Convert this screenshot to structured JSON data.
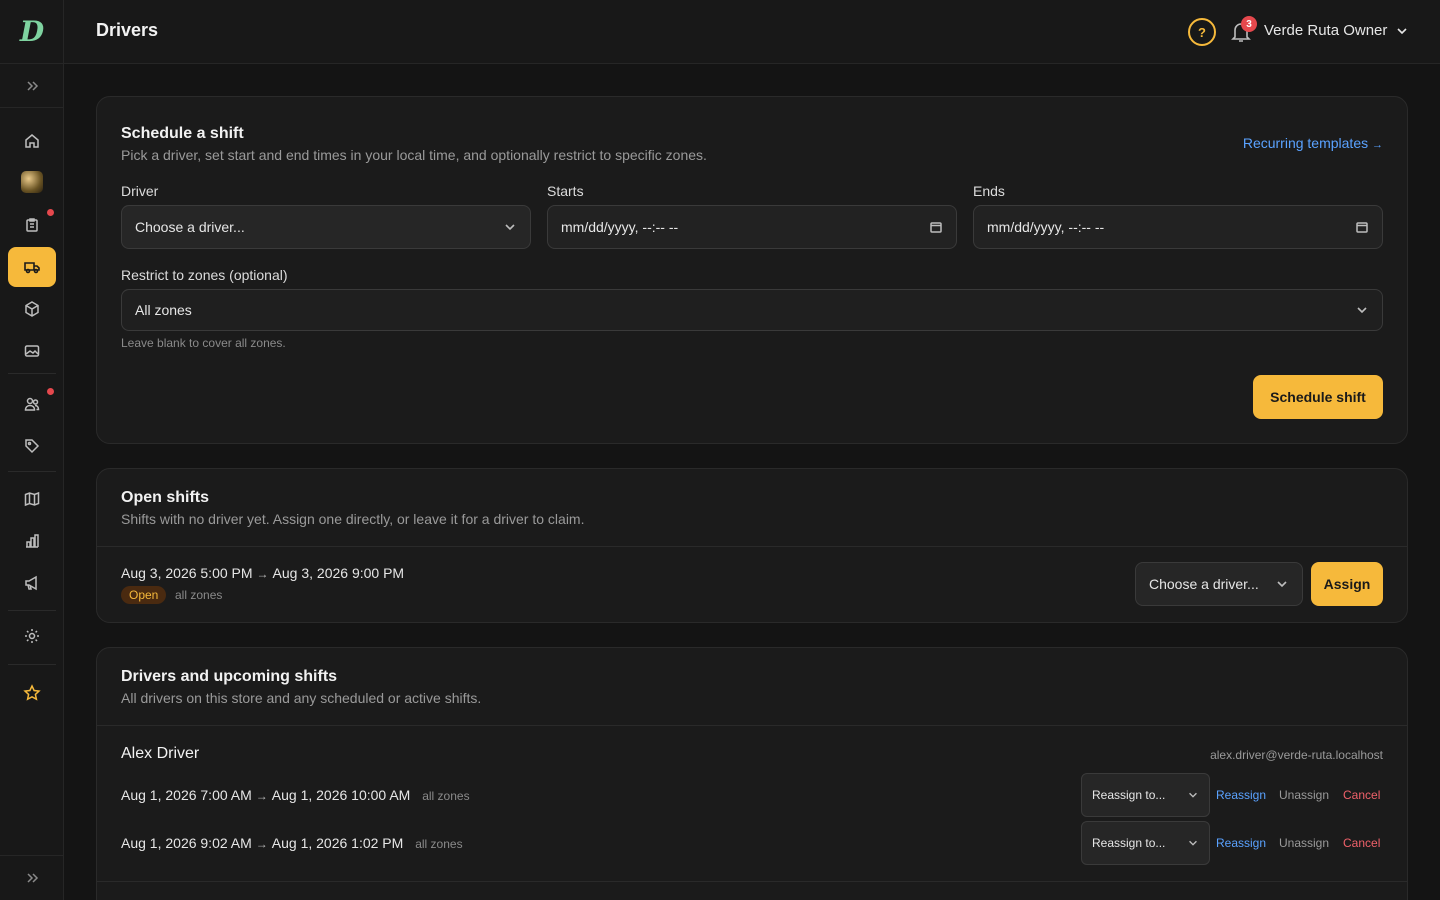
{
  "header": {
    "title": "Drivers",
    "notification_count": "3",
    "user_label": "Verde Ruta Owner"
  },
  "schedule": {
    "title": "Schedule a shift",
    "subtitle": "Pick a driver, set start and end times in your local time, and optionally restrict to specific zones.",
    "recurring_link": "Recurring templates",
    "recurring_arrow": "→",
    "driver_label": "Driver",
    "driver_value": "Choose a driver...",
    "starts_label": "Starts",
    "starts_value": "mm/dd/yyyy, --:-- --",
    "ends_label": "Ends",
    "ends_value": "mm/dd/yyyy, --:-- --",
    "zones_label": "Restrict to zones (optional)",
    "zones_value": "All zones",
    "zones_hint": "Leave blank to cover all zones.",
    "submit_label": "Schedule shift"
  },
  "open_shifts": {
    "title": "Open shifts",
    "subtitle": "Shifts with no driver yet. Assign one directly, or leave it for a driver to claim.",
    "items": [
      {
        "start": "Aug 3, 2026 5:00 PM",
        "end": "Aug 3, 2026 9:00 PM",
        "status": "Open",
        "zones": "all zones",
        "driver_select": "Choose a driver...",
        "assign_label": "Assign"
      }
    ]
  },
  "drivers": {
    "title": "Drivers and upcoming shifts",
    "subtitle": "All drivers on this store and any scheduled or active shifts.",
    "list": [
      {
        "name": "Alex Driver",
        "email": "alex.driver@verde-ruta.localhost",
        "shifts": [
          {
            "start": "Aug 1, 2026 7:00 AM",
            "end": "Aug 1, 2026 10:00 AM",
            "zones": "all zones",
            "reassign_select": "Reassign to...",
            "reassign": "Reassign",
            "unassign": "Unassign",
            "cancel": "Cancel"
          },
          {
            "start": "Aug 1, 2026 9:02 AM",
            "end": "Aug 1, 2026 1:02 PM",
            "zones": "all zones",
            "reassign_select": "Reassign to...",
            "reassign": "Reassign",
            "unassign": "Unassign",
            "cancel": "Cancel"
          }
        ]
      }
    ]
  },
  "arrow": "→",
  "colors": {
    "accent": "#f6b93b",
    "link": "#5aa2ff",
    "danger": "#f0616a",
    "background": "#141414",
    "card": "#1b1b1b"
  },
  "icons": {
    "sidebar": [
      "home-icon",
      "store-avatar",
      "orders-icon",
      "truck-icon",
      "package-icon",
      "image-icon",
      "users-icon",
      "tag-icon",
      "map-icon",
      "chart-icon",
      "megaphone-icon",
      "gear-icon",
      "star-icon"
    ]
  }
}
